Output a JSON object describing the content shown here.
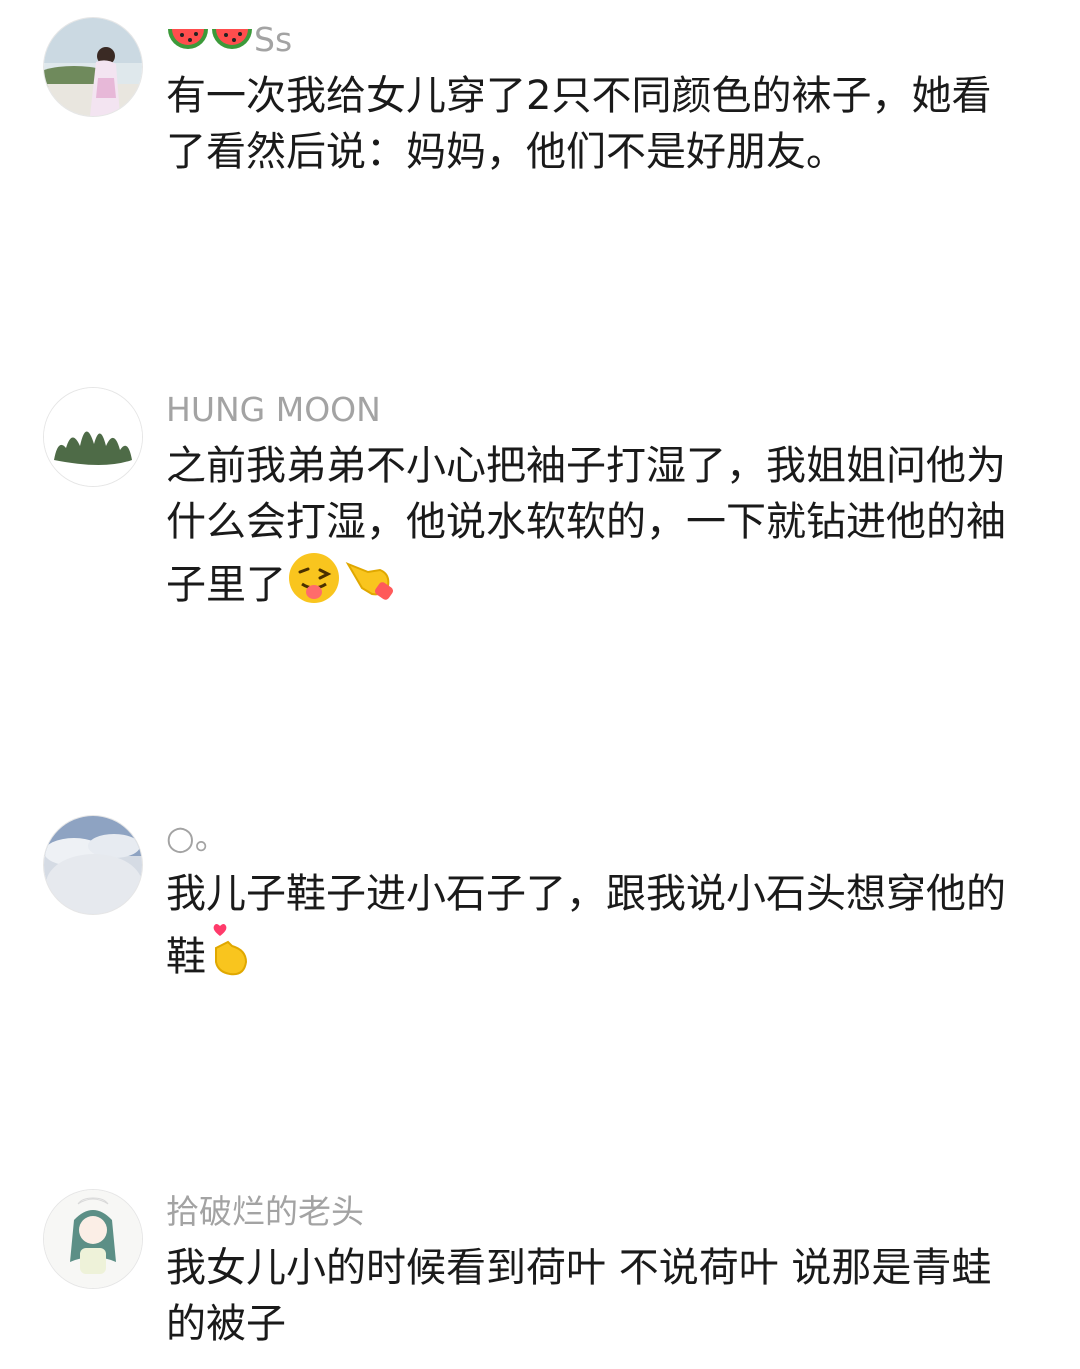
{
  "comments": [
    {
      "username": "Ss",
      "username_emoji": "watermelon-icon x2",
      "text": "有一次我给女儿穿了2只不同颜色的袜子，她看了看然后说：妈妈，他们不是好朋友。"
    },
    {
      "username": "HUNG MOON",
      "text": "之前我弟弟不小心把袖子打湿了，我姐姐问他为什么会打湿，他说水软软的，一下就钻进他的袖子里了",
      "trailing_emoji": [
        "winking-tongue-face-icon",
        "pointing-hand-icon"
      ]
    },
    {
      "username": "○。",
      "text": "我儿子鞋子进小石子了，跟我说小石头想穿他的鞋",
      "trailing_emoji": [
        "finger-heart-icon"
      ]
    },
    {
      "username": "拾破烂的老头",
      "text": "我女儿小的时候看到荷叶 不说荷叶 说那是青蛙的被子"
    }
  ],
  "colors": {
    "username": "#a3a3a3",
    "body_text": "#1a1a1a",
    "background": "#ffffff"
  }
}
